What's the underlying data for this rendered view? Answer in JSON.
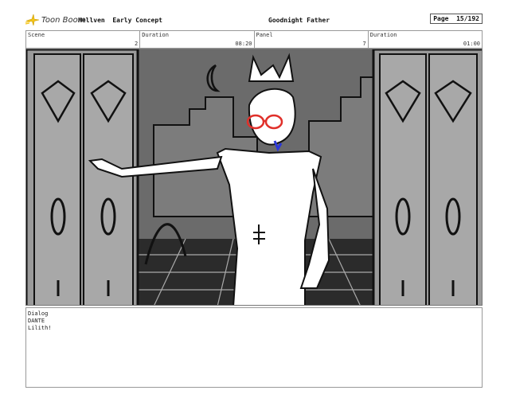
{
  "header": {
    "logo_text": "Toon Boom",
    "project": "Hellven  Early Concept",
    "title": "Goodnight Father",
    "page": "Page  15/192"
  },
  "info": {
    "scene_label": "Scene",
    "scene_value": "2",
    "duration_label": "Duration",
    "duration_value": "08:20",
    "panel_label": "Panel",
    "panel_value": "7",
    "panel_duration_label": "Duration",
    "panel_duration_value": "01:00"
  },
  "dialog": {
    "label": "Dialog",
    "speaker": "DANTE",
    "text": "Lilith!"
  },
  "icons": {
    "logo": "toon-boom-logo-icon"
  },
  "colors": {
    "logo_yellow": "#f5c518",
    "glasses_red": "#e0302a",
    "accent_blue": "#2a37d8"
  }
}
